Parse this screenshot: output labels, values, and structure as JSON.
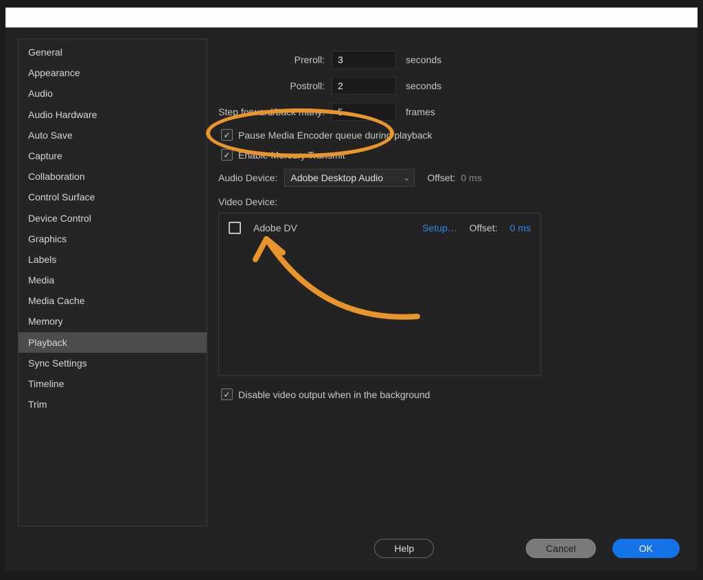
{
  "sidebar": {
    "items": [
      "General",
      "Appearance",
      "Audio",
      "Audio Hardware",
      "Auto Save",
      "Capture",
      "Collaboration",
      "Control Surface",
      "Device Control",
      "Graphics",
      "Labels",
      "Media",
      "Media Cache",
      "Memory",
      "Playback",
      "Sync Settings",
      "Timeline",
      "Trim"
    ],
    "activeIndex": 14
  },
  "fields": {
    "preroll_label": "Preroll:",
    "preroll_value": "3",
    "postroll_label": "Postroll:",
    "postroll_value": "2",
    "step_label": "Step forward/back many:",
    "step_value": "5",
    "seconds_unit": "seconds",
    "frames_unit": "frames"
  },
  "checkboxes": {
    "pause_encoder": "Pause Media Encoder queue during playback",
    "enable_mercury": "Enable Mercury Transmit",
    "disable_bg": "Disable video output when in the background"
  },
  "audio": {
    "label": "Audio Device:",
    "selected": "Adobe Desktop Audio",
    "offset_label": "Offset:",
    "offset_value": "0 ms"
  },
  "video": {
    "label": "Video Device:",
    "device_name": "Adobe DV",
    "setup": "Setup…",
    "offset_label": "Offset:",
    "offset_value": "0 ms"
  },
  "buttons": {
    "help": "Help",
    "cancel": "Cancel",
    "ok": "OK"
  },
  "annotation": {
    "color": "#e8952e"
  }
}
